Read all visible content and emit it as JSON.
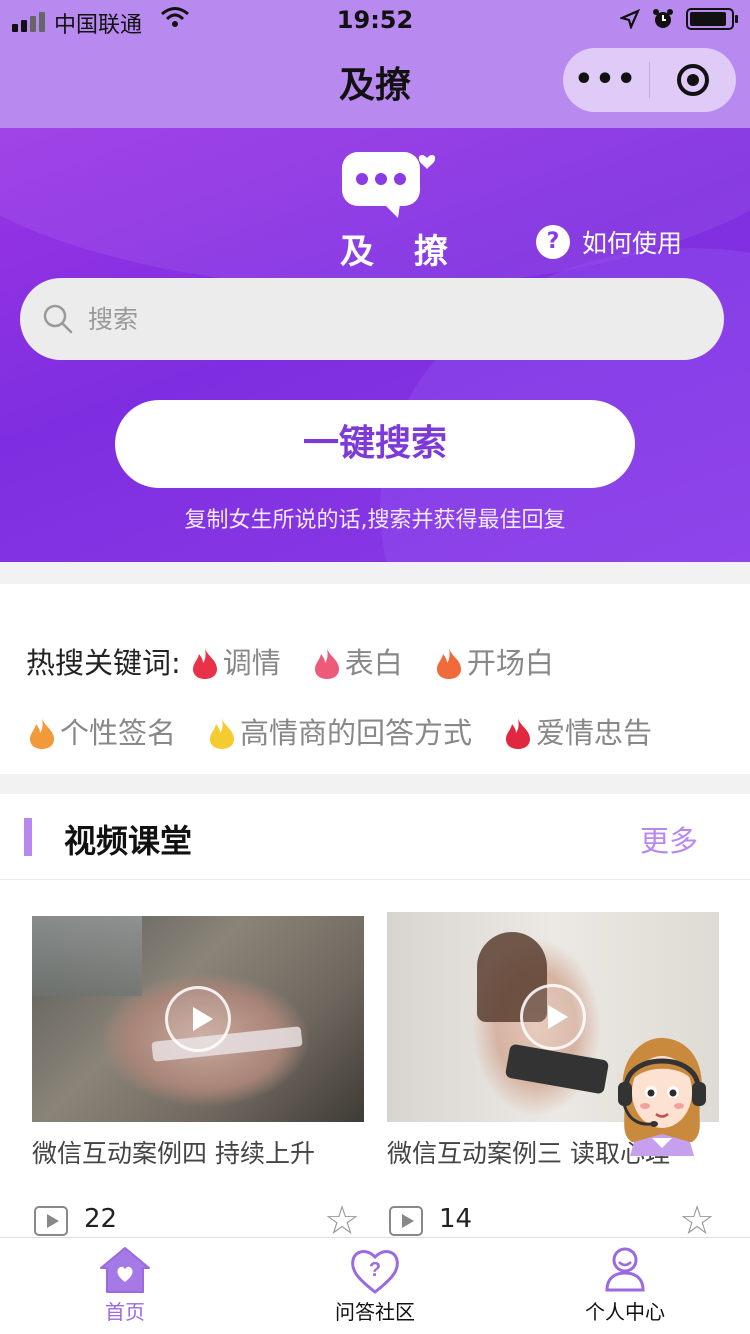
{
  "status_bar": {
    "carrier": "中国联通",
    "time": "19:52"
  },
  "nav": {
    "title": "及撩",
    "more": "•••"
  },
  "hero": {
    "brand": "及 撩",
    "help_label": "如何使用",
    "search_placeholder": "搜索",
    "search_button": "一键搜索",
    "hint": "复制女生所说的话,搜索并获得最佳回复"
  },
  "hot": {
    "lead": "热搜关键词:",
    "keywords": [
      {
        "label": "调情",
        "flame_color": "#e8324a"
      },
      {
        "label": "表白",
        "flame_color": "#ee5a7a"
      },
      {
        "label": "开场白",
        "flame_color": "#f06a3c"
      },
      {
        "label": "个性签名",
        "flame_color": "#f29a3a"
      },
      {
        "label": "高情商的回答方式",
        "flame_color": "#f5cc30"
      },
      {
        "label": "爱情忠告",
        "flame_color": "#e0283e"
      }
    ]
  },
  "videos": {
    "title": "视频课堂",
    "more": "更多",
    "items": [
      {
        "title": "微信互动案例四 持续上升",
        "views": "22"
      },
      {
        "title": "微信互动案例三 读取心理",
        "views": "14"
      }
    ]
  },
  "tabbar": [
    {
      "label": "首页",
      "icon": "home-heart-icon",
      "active": true
    },
    {
      "label": "问答社区",
      "icon": "heart-question-icon",
      "active": false
    },
    {
      "label": "个人中心",
      "icon": "person-icon",
      "active": false
    }
  ],
  "colors": {
    "accent": "#8a3be6",
    "nav_bg": "#b88af0",
    "tab_active": "#9b6ae0"
  }
}
